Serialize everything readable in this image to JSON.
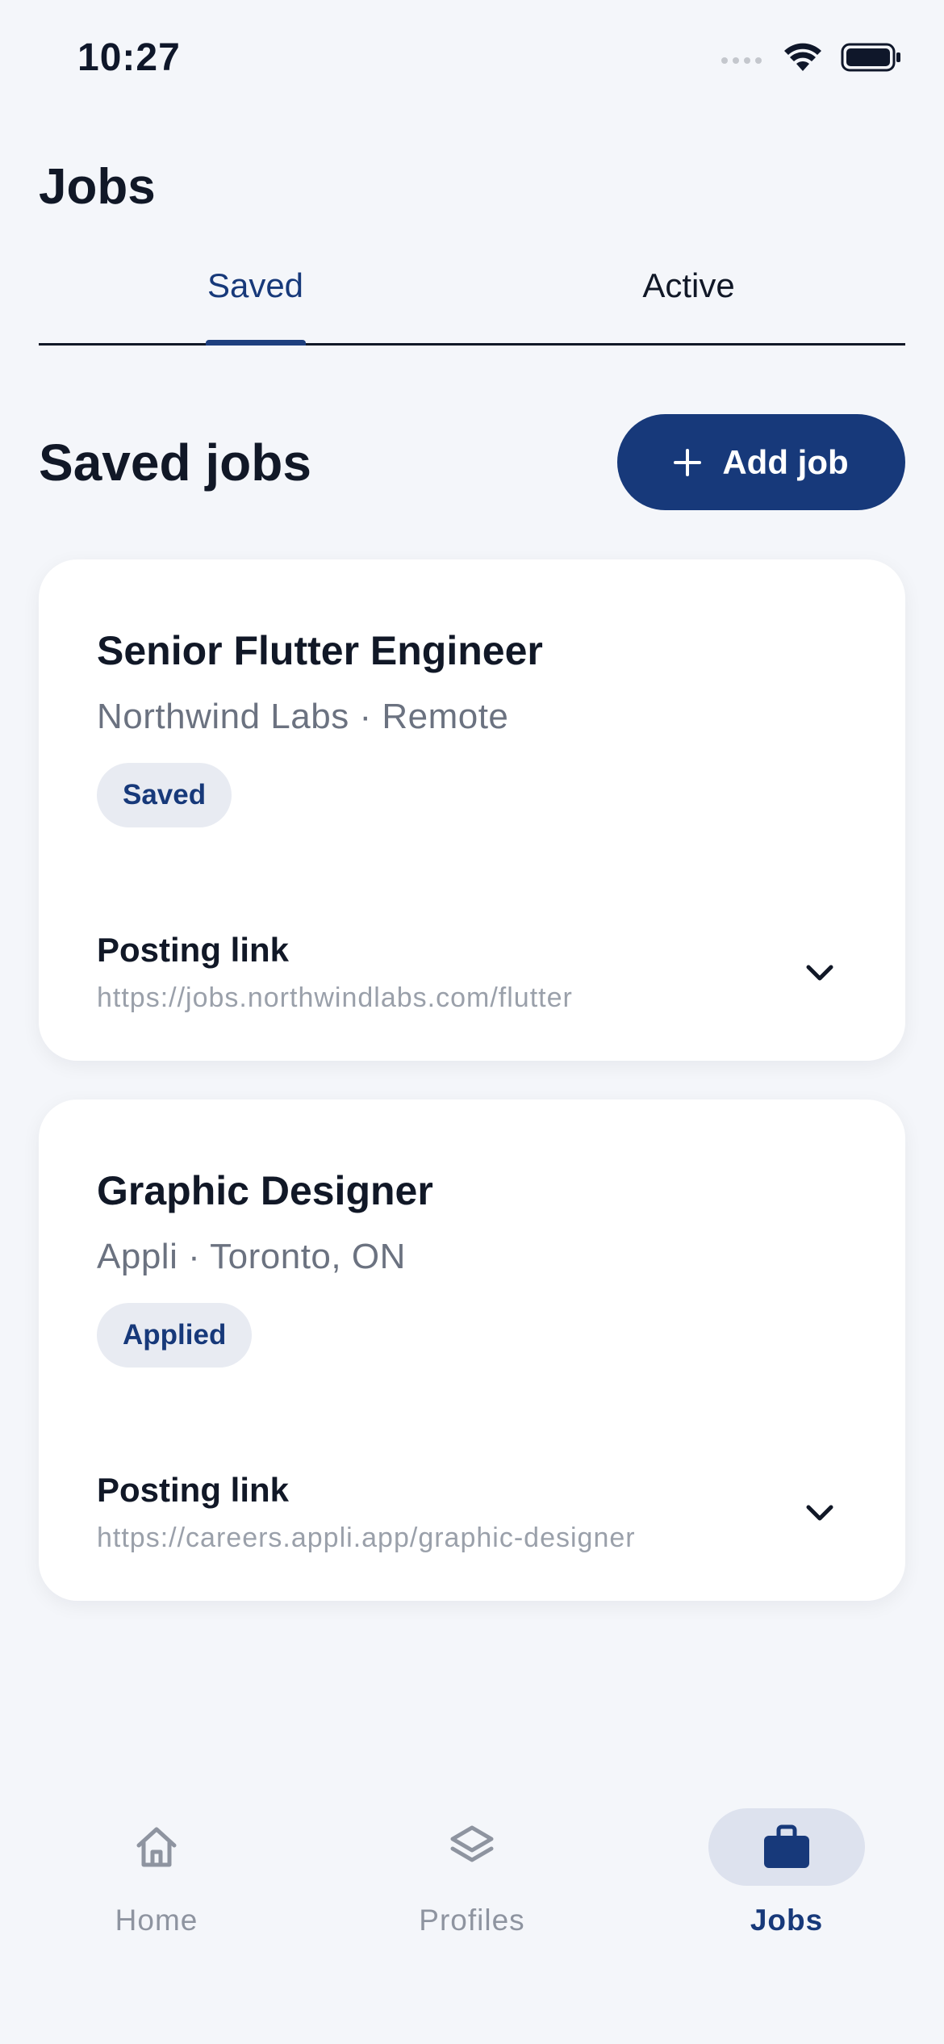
{
  "status_bar": {
    "time": "10:27"
  },
  "header": {
    "title": "Jobs"
  },
  "tabs": [
    {
      "label": "Saved",
      "selected": true
    },
    {
      "label": "Active",
      "selected": false
    }
  ],
  "section": {
    "title": "Saved jobs",
    "add_button_label": "Add job"
  },
  "jobs": [
    {
      "title": "Senior Flutter Engineer",
      "meta": "Northwind Labs · Remote",
      "status": "Saved",
      "posting_label": "Posting link",
      "posting_url": "https://jobs.northwindlabs.com/flutter"
    },
    {
      "title": "Graphic Designer",
      "meta": "Appli · Toronto, ON",
      "status": "Applied",
      "posting_label": "Posting link",
      "posting_url": "https://careers.appli.app/graphic-designer"
    }
  ],
  "bottom_nav": {
    "items": [
      {
        "label": "Home",
        "icon": "home-icon",
        "selected": false
      },
      {
        "label": "Profiles",
        "icon": "layers-icon",
        "selected": false
      },
      {
        "label": "Jobs",
        "icon": "briefcase-icon",
        "selected": true
      }
    ]
  },
  "colors": {
    "accent": "#17397a",
    "background": "#f4f6fa",
    "card": "#ffffff",
    "muted_text": "#6b7280",
    "badge_bg": "#e8ebf2",
    "nav_selected_bg": "#dde2ee"
  }
}
